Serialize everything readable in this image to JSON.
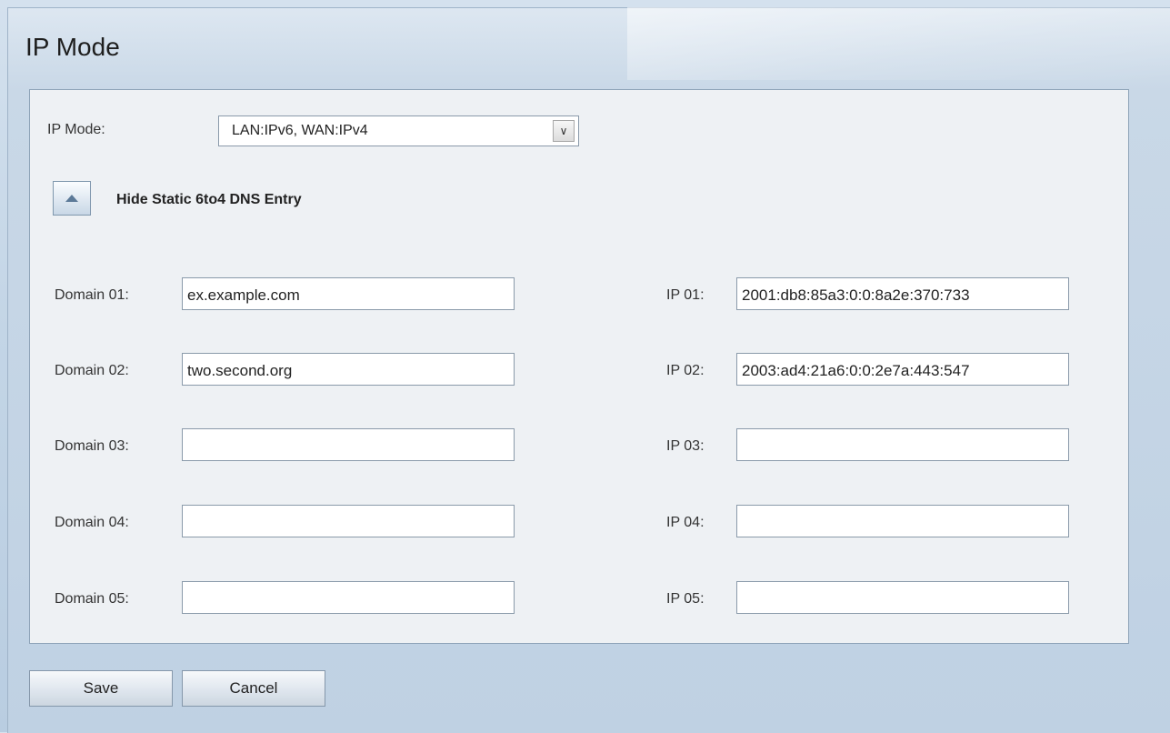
{
  "header": {
    "title": "IP Mode"
  },
  "ip_mode": {
    "label": "IP Mode:",
    "selected": "LAN:IPv6, WAN:IPv4"
  },
  "section": {
    "label": "Hide Static 6to4 DNS Entry"
  },
  "domains": [
    {
      "label": "Domain 01:",
      "value": "ex.example.com"
    },
    {
      "label": "Domain 02:",
      "value": "two.second.org"
    },
    {
      "label": "Domain 03:",
      "value": ""
    },
    {
      "label": "Domain 04:",
      "value": ""
    },
    {
      "label": "Domain 05:",
      "value": ""
    }
  ],
  "ips": [
    {
      "label": "IP 01:",
      "value": "2001:db8:85a3:0:0:8a2e:370:733"
    },
    {
      "label": "IP 02:",
      "value": "2003:ad4:21a6:0:0:2e7a:443:547"
    },
    {
      "label": "IP 03:",
      "value": ""
    },
    {
      "label": "IP 04:",
      "value": ""
    },
    {
      "label": "IP 05:",
      "value": ""
    }
  ],
  "footer": {
    "save_label": "Save",
    "cancel_label": "Cancel"
  }
}
